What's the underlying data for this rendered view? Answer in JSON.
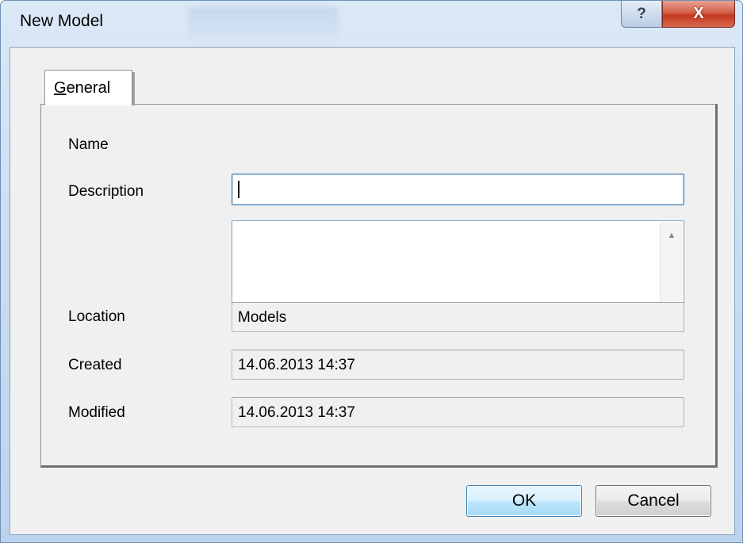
{
  "window": {
    "title": "New Model",
    "help_glyph": "?",
    "close_glyph": "X"
  },
  "tabs": [
    {
      "label_underlined": "G",
      "label_rest": "eneral"
    }
  ],
  "form": {
    "name_label": "Name",
    "name_value": "",
    "description_label": "Description",
    "description_value": "",
    "location_label": "Location",
    "location_value": "Models",
    "created_label": "Created",
    "created_value": "14.06.2013 14:37",
    "modified_label": "Modified",
    "modified_value": "14.06.2013 14:37"
  },
  "scrollbar": {
    "up_glyph": "▲",
    "down_glyph": "▼"
  },
  "buttons": {
    "ok_label": "OK",
    "cancel_label": "Cancel"
  },
  "colors": {
    "close_red": "#c4391f",
    "ok_blue": "#bee6fd",
    "frame_blue": "#c9dcf1"
  }
}
